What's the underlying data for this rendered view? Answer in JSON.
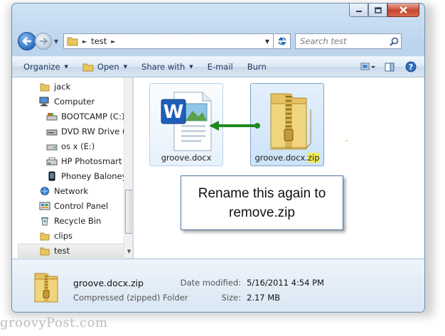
{
  "address": {
    "crumbs": [
      "test"
    ],
    "search_placeholder": "Search test"
  },
  "toolbar": {
    "organize": "Organize",
    "open": "Open",
    "share_with": "Share with",
    "email": "E-mail",
    "burn": "Burn"
  },
  "nav": {
    "items": [
      {
        "label": "jack",
        "icon": "user-folder-icon"
      },
      {
        "label": "Computer",
        "icon": "computer-icon"
      },
      {
        "label": "BOOTCAMP (C:)",
        "icon": "drive-icon"
      },
      {
        "label": "DVD RW Drive (D",
        "icon": "dvd-drive-icon"
      },
      {
        "label": "os x (E:)",
        "icon": "drive-icon"
      },
      {
        "label": "HP Photosmart C",
        "icon": "printer-device-icon"
      },
      {
        "label": "Phoney Baloney",
        "icon": "phone-icon"
      },
      {
        "label": "Network",
        "icon": "network-icon"
      },
      {
        "label": "Control Panel",
        "icon": "control-panel-icon"
      },
      {
        "label": "Recycle Bin",
        "icon": "recycle-bin-icon"
      },
      {
        "label": "clips",
        "icon": "folder-icon"
      },
      {
        "label": "test",
        "icon": "folder-icon"
      }
    ],
    "selected": "test"
  },
  "files": [
    {
      "name": "groove.docx",
      "icon": "word-document-icon"
    },
    {
      "name_base": "groove.docx.",
      "name_ext": "zip",
      "icon": "zip-folder-icon",
      "selected": true
    }
  ],
  "callout": {
    "text": "Rename this again to remove.zip"
  },
  "details": {
    "name": "groove.docx.zip",
    "type": "Compressed (zipped) Folder",
    "modified_label": "Date modified:",
    "modified_value": "5/16/2011 4:54 PM",
    "size_label": "Size:",
    "size_value": "2.17 MB"
  },
  "watermark": "groovyPost.com",
  "colors": {
    "accent_arrow": "#1f8a1f",
    "zip_highlight": "#f1ec5c",
    "callout_border": "#4a76aa"
  }
}
